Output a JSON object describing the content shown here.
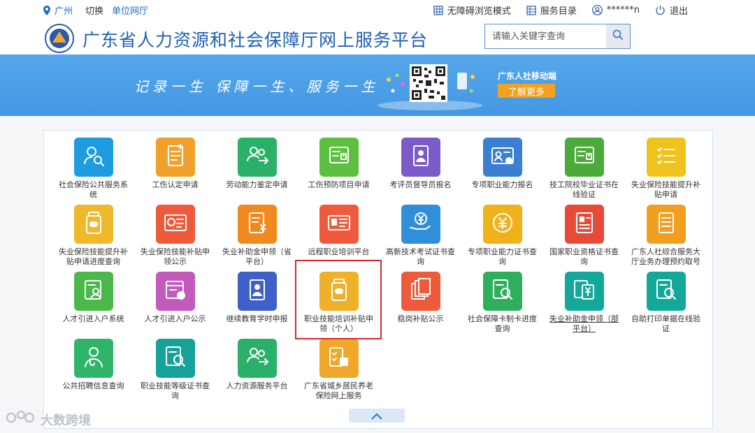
{
  "topbar": {
    "location": "广州",
    "switch_label": "切换",
    "hall_label": "单位网厅",
    "accessibility_label": "无障碍浏览模式",
    "service_catalog_label": "服务目录",
    "user_label": "******n",
    "logout_label": "退出"
  },
  "header": {
    "site_title": "广东省人力资源和社会保障厅网上服务平台",
    "search_placeholder": "请输入关键字查询"
  },
  "banner": {
    "slogan": "记录一生  保障一生、服务一生",
    "mobile_label": "广东人社移动端",
    "more_button": "了解更多"
  },
  "tiles": [
    {
      "label": "社会保险公共服务系统",
      "color": "#1d9de0",
      "icon": "person-search-icon"
    },
    {
      "label": "工伤认定申请",
      "color": "#f0a12a",
      "icon": "document-plus-icon"
    },
    {
      "label": "劳动能力鉴定申请",
      "color": "#2bb06a",
      "icon": "people-exchange-icon"
    },
    {
      "label": "工伤预防项目申请",
      "color": "#5bbf3f",
      "icon": "certificate-icon"
    },
    {
      "label": "考评员督导员报名",
      "color": "#7a5bc7",
      "icon": "badge-person-icon"
    },
    {
      "label": "专项职业能力报名",
      "color": "#3a7fd1",
      "icon": "id-card-edit-icon"
    },
    {
      "label": "技工院校毕业证书在线验证",
      "color": "#4aaa3a",
      "icon": "certificate-icon"
    },
    {
      "label": "失业保险技能提升补贴申请",
      "color": "#f0c21e",
      "icon": "checklist-icon"
    },
    {
      "label": "失业保险技能提升补贴申请进度查询",
      "color": "#f0b82a",
      "icon": "medicine-jar-icon"
    },
    {
      "label": "失业保险技能补贴申领公示",
      "color": "#ef5a3c",
      "icon": "money-card-icon"
    },
    {
      "label": "失业补助金申领（省平台）",
      "color": "#f08a1e",
      "icon": "document-yuan-icon"
    },
    {
      "label": "远程职业培训平台",
      "color": "#ef5a3c",
      "icon": "id-card-icon"
    },
    {
      "label": "高新技术考试证书查询",
      "color": "#2f8fd8",
      "icon": "hand-yuan-icon"
    },
    {
      "label": "专项职业能力证书查询",
      "color": "#f0b21a",
      "icon": "yuan-coin-icon"
    },
    {
      "label": "国家职业资格证书查询",
      "color": "#e84a3a",
      "icon": "profile-doc-icon"
    },
    {
      "label": "广东人社综合服务大厅业务办理预约取号",
      "color": "#f0a01e",
      "icon": "document-lines-icon"
    },
    {
      "label": "人才引进入户系统",
      "color": "#4cb84a",
      "icon": "doc-person-icon"
    },
    {
      "label": "人才引进入户公示",
      "color": "#c35bbd",
      "icon": "calendar-dollar-icon"
    },
    {
      "label": "继续教育学时申报",
      "color": "#3f5fc9",
      "icon": "badge-person-icon"
    },
    {
      "label": "职业技能培训补贴申领（个人）",
      "color": "#f0b12a",
      "icon": "medicine-jar-icon"
    },
    {
      "label": "稳岗补贴公示",
      "color": "#ee5a3a",
      "icon": "stacked-docs-icon"
    },
    {
      "label": "社会保障卡制卡进度查询",
      "color": "#2fae5e",
      "icon": "doc-search-icon"
    },
    {
      "label": "失业补助金申领（部平台）",
      "color": "#13a89a",
      "icon": "doc-yuan-icon",
      "underline": true
    },
    {
      "label": "自助打印单据在线验证",
      "color": "#13a89a",
      "icon": "doc-search-icon"
    },
    {
      "label": "公共招聘信息查询",
      "color": "#2fb46a",
      "icon": "doctor-icon"
    },
    {
      "label": "职业技能等级证书查询",
      "color": "#16a29a",
      "icon": "doc-search-icon"
    },
    {
      "label": "人力资源服务平台",
      "color": "#2bb06a",
      "icon": "people-exchange-icon"
    },
    {
      "label": "广东省城乡居民养老保险网上服务",
      "color": "#f0a82a",
      "icon": "checklist-plus-icon"
    }
  ],
  "watermark": "大数跨境"
}
